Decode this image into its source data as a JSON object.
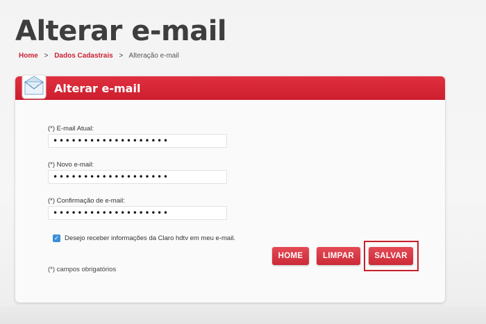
{
  "page": {
    "title": "Alterar e-mail"
  },
  "breadcrumb": {
    "items": [
      "Home",
      "Dados Cadastrais",
      "Alteração e-mail"
    ],
    "separator": ">"
  },
  "panel": {
    "title": "Alterar e-mail",
    "icon": "envelope-icon"
  },
  "form": {
    "current_email_label": "(*) E-mail Atual:",
    "current_email_value": "•••••••••••••••••••",
    "new_email_label": "(*) Novo e-mail:",
    "new_email_value": "•••••••••••••••••••",
    "confirm_email_label": "(*) Confirmação de e-mail:",
    "confirm_email_value": "•••••••••••••••••••",
    "newsletter_label": "Desejo receber informações da Claro hdtv em meu e-mail.",
    "newsletter_checked": true,
    "required_note": "(*) campos obrigatórios"
  },
  "buttons": {
    "home": "HOME",
    "clear": "LIMPAR",
    "save": "SALVAR"
  },
  "colors": {
    "accent": "#d42637",
    "checkbox": "#3a8fd8",
    "highlight": "#c8202a"
  }
}
